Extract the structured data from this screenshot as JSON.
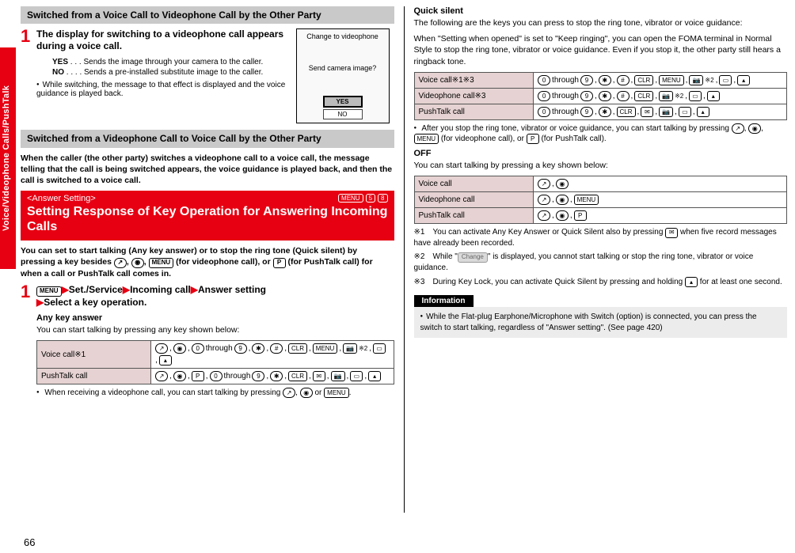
{
  "sideTab": "Voice/Videophone Calls/PushTalk",
  "pageNumber": "66",
  "left": {
    "band1": "Switched from a Voice Call to Videophone Call by the Other Party",
    "step1_text": "The display for switching to a videophone call appears during a voice call.",
    "screenshot": {
      "line1": "Change to videophone",
      "line2": "Send camera image?",
      "yes": "YES",
      "no": "NO"
    },
    "yes_label": "YES",
    "yes_dots": ". . .",
    "yes_desc": "Sends the image through your camera to the caller.",
    "no_label": "NO",
    "no_dots": ". . . .",
    "no_desc": "Sends a pre-installed substitute image to the caller.",
    "bullet1": "While switching, the message to that effect is displayed and the voice guidance is played back.",
    "band2": "Switched from a Videophone Call to Voice Call by the Other Party",
    "para2": "When the caller (the other party) switches a videophone call to a voice call, the message telling that the call is being switched appears, the voice guidance is played back, and then the call is switched to a voice call.",
    "redband_setting": "<Answer Setting>",
    "redband_menu": "MENU",
    "redband_d1": "5",
    "redband_d2": "8",
    "redband_title": "Setting Response of Key Operation for Answering Incoming Calls",
    "para3_a": "You can set to start talking (Any key answer) or to stop the ring tone (Quick silent) by pressing a key besides ",
    "para3_b": " (for videophone call), or ",
    "para3_c": " (for PushTalk call) for when a call or PushTalk call comes in.",
    "step2_menu": "MENU",
    "step2_a": "Set./Service",
    "step2_b": "Incoming call",
    "step2_c": "Answer setting",
    "step2_d": "Select a key operation.",
    "subhead_any": "Any key answer",
    "any_desc": "You can start talking by pressing any key shown below:",
    "table_any": {
      "r1_label": "Voice call※1",
      "r1_through": "through",
      "r1_note": "※2",
      "r2_label": "PushTalk call",
      "r2_through": "through"
    },
    "bullet2_a": "When receiving a videophone call, you can start talking by pressing ",
    "bullet2_b": " or "
  },
  "right": {
    "subhead_quick": "Quick silent",
    "quick_p1": "The following are the keys you can press to stop the ring tone, vibrator or voice guidance:",
    "quick_p2": "When \"Setting when opened\" is set to \"Keep ringing\", you can open the FOMA terminal in Normal Style to stop the ring tone, vibrator or voice guidance. Even if you stop it, the other party still hears a ringback tone.",
    "table_quick": {
      "r1_label": "Voice call※1※3",
      "r2_label": "Videophone call※3",
      "r3_label": "PushTalk call",
      "through": "through",
      "note2": "※2"
    },
    "bullet_after_a": "After you stop the ring tone, vibrator or voice guidance, you can start talking by pressing ",
    "bullet_after_b": " (for videophone call), or ",
    "bullet_after_c": " (for PushTalk call).",
    "subhead_off": "OFF",
    "off_desc": "You can start talking by pressing a key shown below:",
    "table_off": {
      "r1_label": "Voice call",
      "r2_label": "Videophone call",
      "r3_label": "PushTalk call"
    },
    "notes": {
      "n1_mark": "※1",
      "n1_text": "You can activate Any Key Answer or Quick Silent also by pressing  when five record messages have already been recorded.",
      "n2_mark": "※2",
      "n2_a": "While \"",
      "n2_chip": "Change",
      "n2_b": "\" is displayed, you cannot start talking or stop the ring tone, vibrator or voice guidance.",
      "n3_mark": "※3",
      "n3_text": "During Key Lock, you can activate Quick Silent by pressing and holding  for at least one second."
    },
    "info_head": "Information",
    "info_body": "While the Flat-plug Earphone/Microphone with Switch (option) is connected, you can press the switch to start talking, regardless of \"Answer setting\". (See page 420)"
  }
}
